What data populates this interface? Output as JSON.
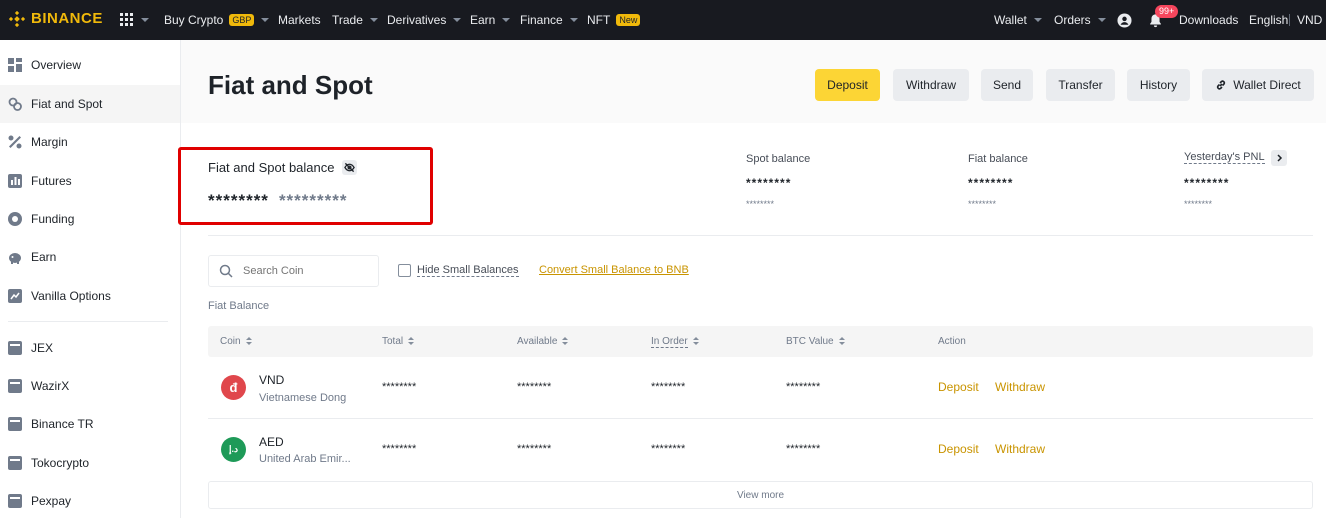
{
  "topbar": {
    "brand": "BINANCE",
    "nav": [
      {
        "label": "Buy Crypto",
        "tag": "GBP"
      },
      {
        "label": "Markets"
      },
      {
        "label": "Trade"
      },
      {
        "label": "Derivatives"
      },
      {
        "label": "Earn"
      },
      {
        "label": "Finance"
      },
      {
        "label": "NFT",
        "tag": "New"
      }
    ],
    "right": {
      "wallet": "Wallet",
      "orders": "Orders",
      "notif_badge": "99+",
      "downloads": "Downloads",
      "language": "English",
      "currency": "VND"
    }
  },
  "sidebar": {
    "items": [
      {
        "label": "Overview",
        "icon": "grid-icon"
      },
      {
        "label": "Fiat and Spot",
        "icon": "coins-icon",
        "active": true
      },
      {
        "label": "Margin",
        "icon": "percent-icon"
      },
      {
        "label": "Futures",
        "icon": "futures-icon"
      },
      {
        "label": "Funding",
        "icon": "funding-icon"
      },
      {
        "label": "Earn",
        "icon": "piggy-bank-icon"
      },
      {
        "label": "Vanilla Options",
        "icon": "options-icon"
      },
      {
        "label": "JEX",
        "icon": "card-icon"
      },
      {
        "label": "WazirX",
        "icon": "card-icon"
      },
      {
        "label": "Binance TR",
        "icon": "card-icon"
      },
      {
        "label": "Tokocrypto",
        "icon": "card-icon"
      },
      {
        "label": "Pexpay",
        "icon": "card-icon"
      }
    ]
  },
  "header": {
    "title": "Fiat and Spot",
    "buttons": {
      "deposit": "Deposit",
      "withdraw": "Withdraw",
      "send": "Send",
      "transfer": "Transfer",
      "history": "History",
      "wallet_direct": "Wallet Direct"
    }
  },
  "balance": {
    "label": "Fiat and Spot balance",
    "value": "********",
    "value_secondary": "*********",
    "spot": {
      "label": "Spot balance",
      "value": "********",
      "sub": "********"
    },
    "fiat": {
      "label": "Fiat balance",
      "value": "********",
      "sub": "********"
    },
    "pnl": {
      "label": "Yesterday's PNL",
      "value": "********",
      "sub": "********"
    }
  },
  "filters": {
    "search_placeholder": "Search Coin",
    "hide_small": "Hide Small Balances",
    "convert_link": "Convert Small Balance to BNB"
  },
  "section_label": "Fiat Balance",
  "table": {
    "headers": [
      "Coin",
      "Total",
      "Available",
      "In Order",
      "BTC Value",
      "Action"
    ],
    "rows": [
      {
        "symbol": "VND",
        "name": "Vietnamese Dong",
        "total": "********",
        "available": "********",
        "in_order": "********",
        "btc": "********",
        "deposit": "Deposit",
        "withdraw": "Withdraw",
        "color": "#e0474c",
        "glyph": "đ"
      },
      {
        "symbol": "AED",
        "name": "United Arab Emir...",
        "total": "********",
        "available": "********",
        "in_order": "********",
        "btc": "********",
        "deposit": "Deposit",
        "withdraw": "Withdraw",
        "color": "#1e9a58",
        "glyph": "د.إ"
      }
    ],
    "view_more": "View more"
  },
  "colors": {
    "accent": "#fcd535",
    "highlight_border": "#e00000",
    "link": "#c99400"
  }
}
